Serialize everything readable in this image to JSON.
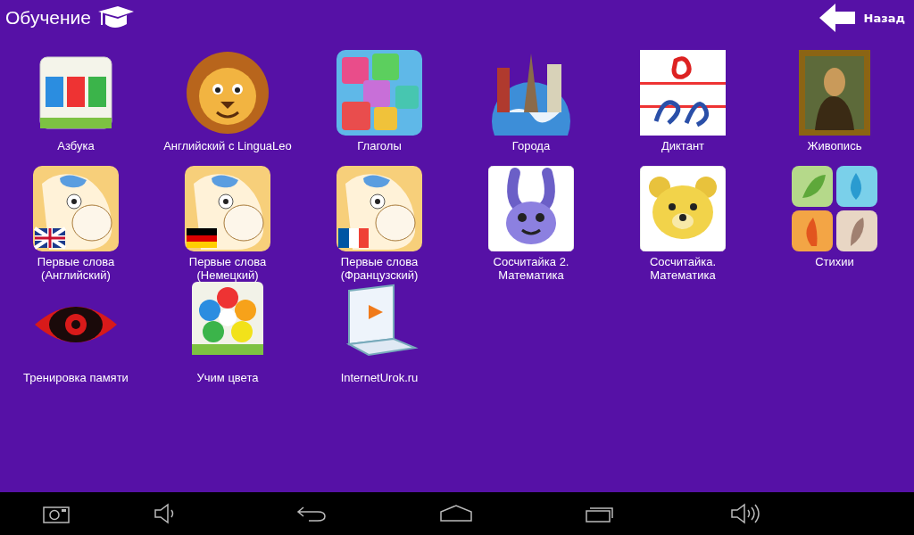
{
  "header": {
    "title": "Обучение",
    "back_label": "Назад"
  },
  "apps": [
    {
      "label": "Азбука",
      "kind": "letters"
    },
    {
      "label": "Английский с LinguaLeo",
      "kind": "lion"
    },
    {
      "label": "Глаголы",
      "kind": "blocks"
    },
    {
      "label": "Города",
      "kind": "globe"
    },
    {
      "label": "Диктант",
      "kind": "dictation"
    },
    {
      "label": "Живопись",
      "kind": "painting"
    },
    {
      "label": "Первые слова (Английский)",
      "kind": "pony_uk"
    },
    {
      "label": "Первые слова (Немецкий)",
      "kind": "pony_de"
    },
    {
      "label": "Первые слова (Французский)",
      "kind": "pony_fr"
    },
    {
      "label": "Сосчитайка 2. Математика",
      "kind": "bunny"
    },
    {
      "label": "Сосчитайка. Математика",
      "kind": "bear"
    },
    {
      "label": "Стихии",
      "kind": "elements"
    },
    {
      "label": "Тренировка памяти",
      "kind": "eye"
    },
    {
      "label": "Учим цвета",
      "kind": "flower"
    },
    {
      "label": "InternetUrok.ru",
      "kind": "laptop"
    }
  ]
}
